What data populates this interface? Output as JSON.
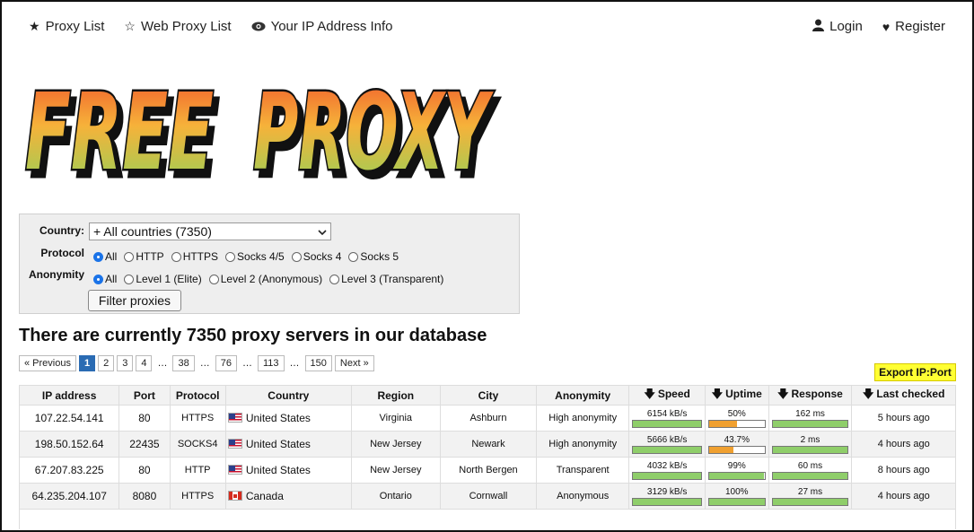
{
  "nav": {
    "left": [
      {
        "icon": "star-filled-icon",
        "glyph": "★",
        "label": "Proxy List"
      },
      {
        "icon": "star-outline-icon",
        "glyph": "☆",
        "label": "Web Proxy List"
      },
      {
        "icon": "eye-icon",
        "glyph": "👁",
        "label": "Your IP Address Info"
      }
    ],
    "right": [
      {
        "icon": "user-icon",
        "glyph": "👤",
        "label": "Login"
      },
      {
        "icon": "heart-icon",
        "glyph": "♥",
        "label": "Register"
      }
    ]
  },
  "logo": {
    "text": "FREE PROXY"
  },
  "filter": {
    "country_label": "Country:",
    "country_value": "+ All countries (7350)",
    "protocol_label": "Protocol",
    "protocol_options": [
      "All",
      "HTTP",
      "HTTPS",
      "Socks 4/5",
      "Socks 4",
      "Socks 5"
    ],
    "protocol_selected": "All",
    "anonymity_label": "Anonymity",
    "anonymity_options": [
      "All",
      "Level 1 (Elite)",
      "Level 2 (Anonymous)",
      "Level 3 (Transparent)"
    ],
    "anonymity_selected": "All",
    "button": "Filter proxies"
  },
  "headline": "There are currently 7350 proxy servers in our database",
  "pagination": {
    "prev": "« Previous",
    "pages": [
      "1",
      "2",
      "3",
      "4",
      "…",
      "38",
      "…",
      "76",
      "…",
      "113",
      "…",
      "150"
    ],
    "current": "1",
    "next": "Next »"
  },
  "export_button": "Export IP:Port",
  "table": {
    "headers": [
      "IP address",
      "Port",
      "Protocol",
      "Country",
      "Region",
      "City",
      "Anonymity",
      "Speed",
      "Uptime",
      "Response",
      "Last checked"
    ],
    "rows": [
      {
        "ip": "107.22.54.141",
        "port": "80",
        "protocol": "HTTPS",
        "country": "United States",
        "flag": "us",
        "region": "Virginia",
        "city": "Ashburn",
        "anonymity": "High anonymity",
        "speed": "6154 kB/s",
        "speed_pct": 100,
        "uptime": "50%",
        "uptime_pct": 50,
        "response": "162 ms",
        "response_pct": 100,
        "checked": "5 hours ago"
      },
      {
        "ip": "198.50.152.64",
        "port": "22435",
        "protocol": "SOCKS4",
        "country": "United States",
        "flag": "us",
        "region": "New Jersey",
        "city": "Newark",
        "anonymity": "High anonymity",
        "speed": "5666 kB/s",
        "speed_pct": 100,
        "uptime": "43.7%",
        "uptime_pct": 43.7,
        "response": "2 ms",
        "response_pct": 100,
        "checked": "4 hours ago"
      },
      {
        "ip": "67.207.83.225",
        "port": "80",
        "protocol": "HTTP",
        "country": "United States",
        "flag": "us",
        "region": "New Jersey",
        "city": "North Bergen",
        "anonymity": "Transparent",
        "speed": "4032 kB/s",
        "speed_pct": 100,
        "uptime": "99%",
        "uptime_pct": 99,
        "response": "60 ms",
        "response_pct": 100,
        "checked": "8 hours ago"
      },
      {
        "ip": "64.235.204.107",
        "port": "8080",
        "protocol": "HTTPS",
        "country": "Canada",
        "flag": "ca",
        "region": "Ontario",
        "city": "Cornwall",
        "anonymity": "Anonymous",
        "speed": "3129 kB/s",
        "speed_pct": 100,
        "uptime": "100%",
        "uptime_pct": 100,
        "response": "27 ms",
        "response_pct": 100,
        "checked": "4 hours ago"
      }
    ]
  },
  "colors": {
    "bar_good": "#8fce6a",
    "bar_warn": "#f0a030",
    "page_active": "#2a6bb3",
    "export_bg": "#ffff33"
  }
}
